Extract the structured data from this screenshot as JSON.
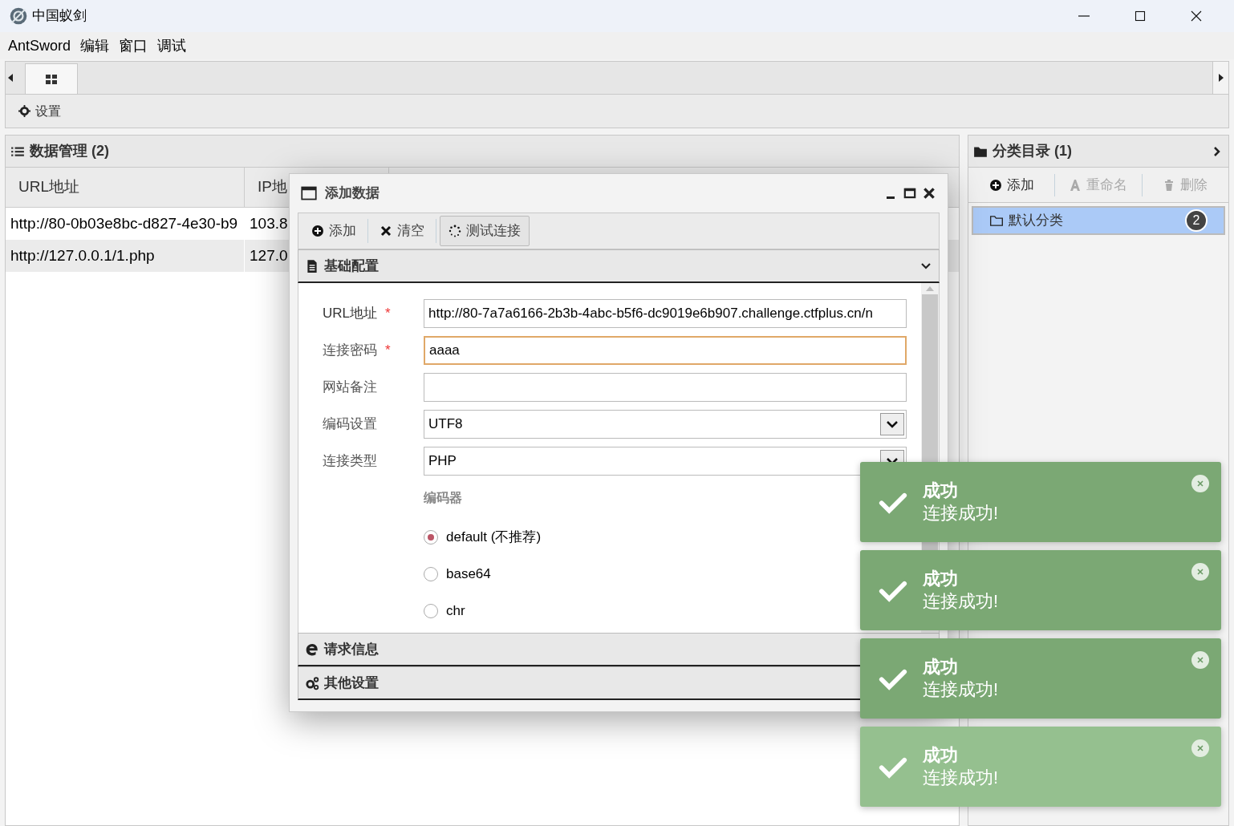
{
  "window": {
    "title": "中国蚁剑"
  },
  "menu": [
    "AntSword",
    "编辑",
    "窗口",
    "调试"
  ],
  "tabs": [
    {
      "kind": "grid",
      "selected": true
    }
  ],
  "toolbar": [
    {
      "kind": "gear",
      "label": "设置"
    }
  ],
  "data_panel": {
    "title": "数据管理 (2)",
    "columns": [
      "URL地址",
      "IP地"
    ],
    "rows": [
      {
        "cells": [
          "http://80-0b03e8bc-d827-4e30-b9",
          "103.8"
        ]
      },
      {
        "cells": [
          "http://127.0.0.1/1.php",
          "127.0"
        ]
      }
    ]
  },
  "category_panel": {
    "title": "分类目录 (1)",
    "actions": [
      {
        "kind": "add",
        "label": "添加",
        "disabled": false
      },
      {
        "kind": "rename",
        "label": "重命名",
        "disabled": true
      },
      {
        "kind": "delete",
        "label": "删除",
        "disabled": true
      }
    ],
    "items": [
      {
        "label": "默认分类",
        "count": "2",
        "selected": true
      }
    ]
  },
  "dialog": {
    "title": "添加数据",
    "actions": [
      {
        "kind": "add",
        "label": "添加"
      },
      {
        "kind": "clear",
        "label": "清空"
      },
      {
        "kind": "test",
        "label": "测试连接"
      }
    ],
    "sections": [
      {
        "kind": "basic",
        "title": "基础配置",
        "expanded": true
      },
      {
        "kind": "request",
        "title": "请求信息",
        "expanded": false
      },
      {
        "kind": "other",
        "title": "其他设置",
        "expanded": false
      }
    ],
    "fields": [
      {
        "kind": "text",
        "label": "URL地址",
        "required_mark": "*",
        "value": "http://80-7a7a6166-2b3b-4abc-b5f6-dc9019e6b907.challenge.ctfplus.cn/n",
        "focused": false
      },
      {
        "kind": "text",
        "label": "连接密码",
        "required_mark": "*",
        "value": "aaaa",
        "focused": true
      },
      {
        "kind": "text",
        "label": "网站备注",
        "focused": false
      },
      {
        "kind": "select",
        "label": "编码设置",
        "value": "UTF8",
        "focused": false
      },
      {
        "kind": "select",
        "label": "连接类型",
        "value": "PHP",
        "focused": false
      }
    ],
    "encoder": {
      "title": "编码器",
      "options": [
        {
          "label": "default (不推荐)",
          "selected": true
        },
        {
          "label": "base64",
          "selected": false
        },
        {
          "label": "chr",
          "selected": false
        }
      ]
    }
  },
  "toasts": [
    {
      "title": "成功",
      "message": "连接成功!",
      "fading": false
    },
    {
      "title": "成功",
      "message": "连接成功!",
      "fading": false
    },
    {
      "title": "成功",
      "message": "连接成功!",
      "fading": false
    },
    {
      "title": "成功",
      "message": "连接成功!",
      "fading": true
    }
  ]
}
